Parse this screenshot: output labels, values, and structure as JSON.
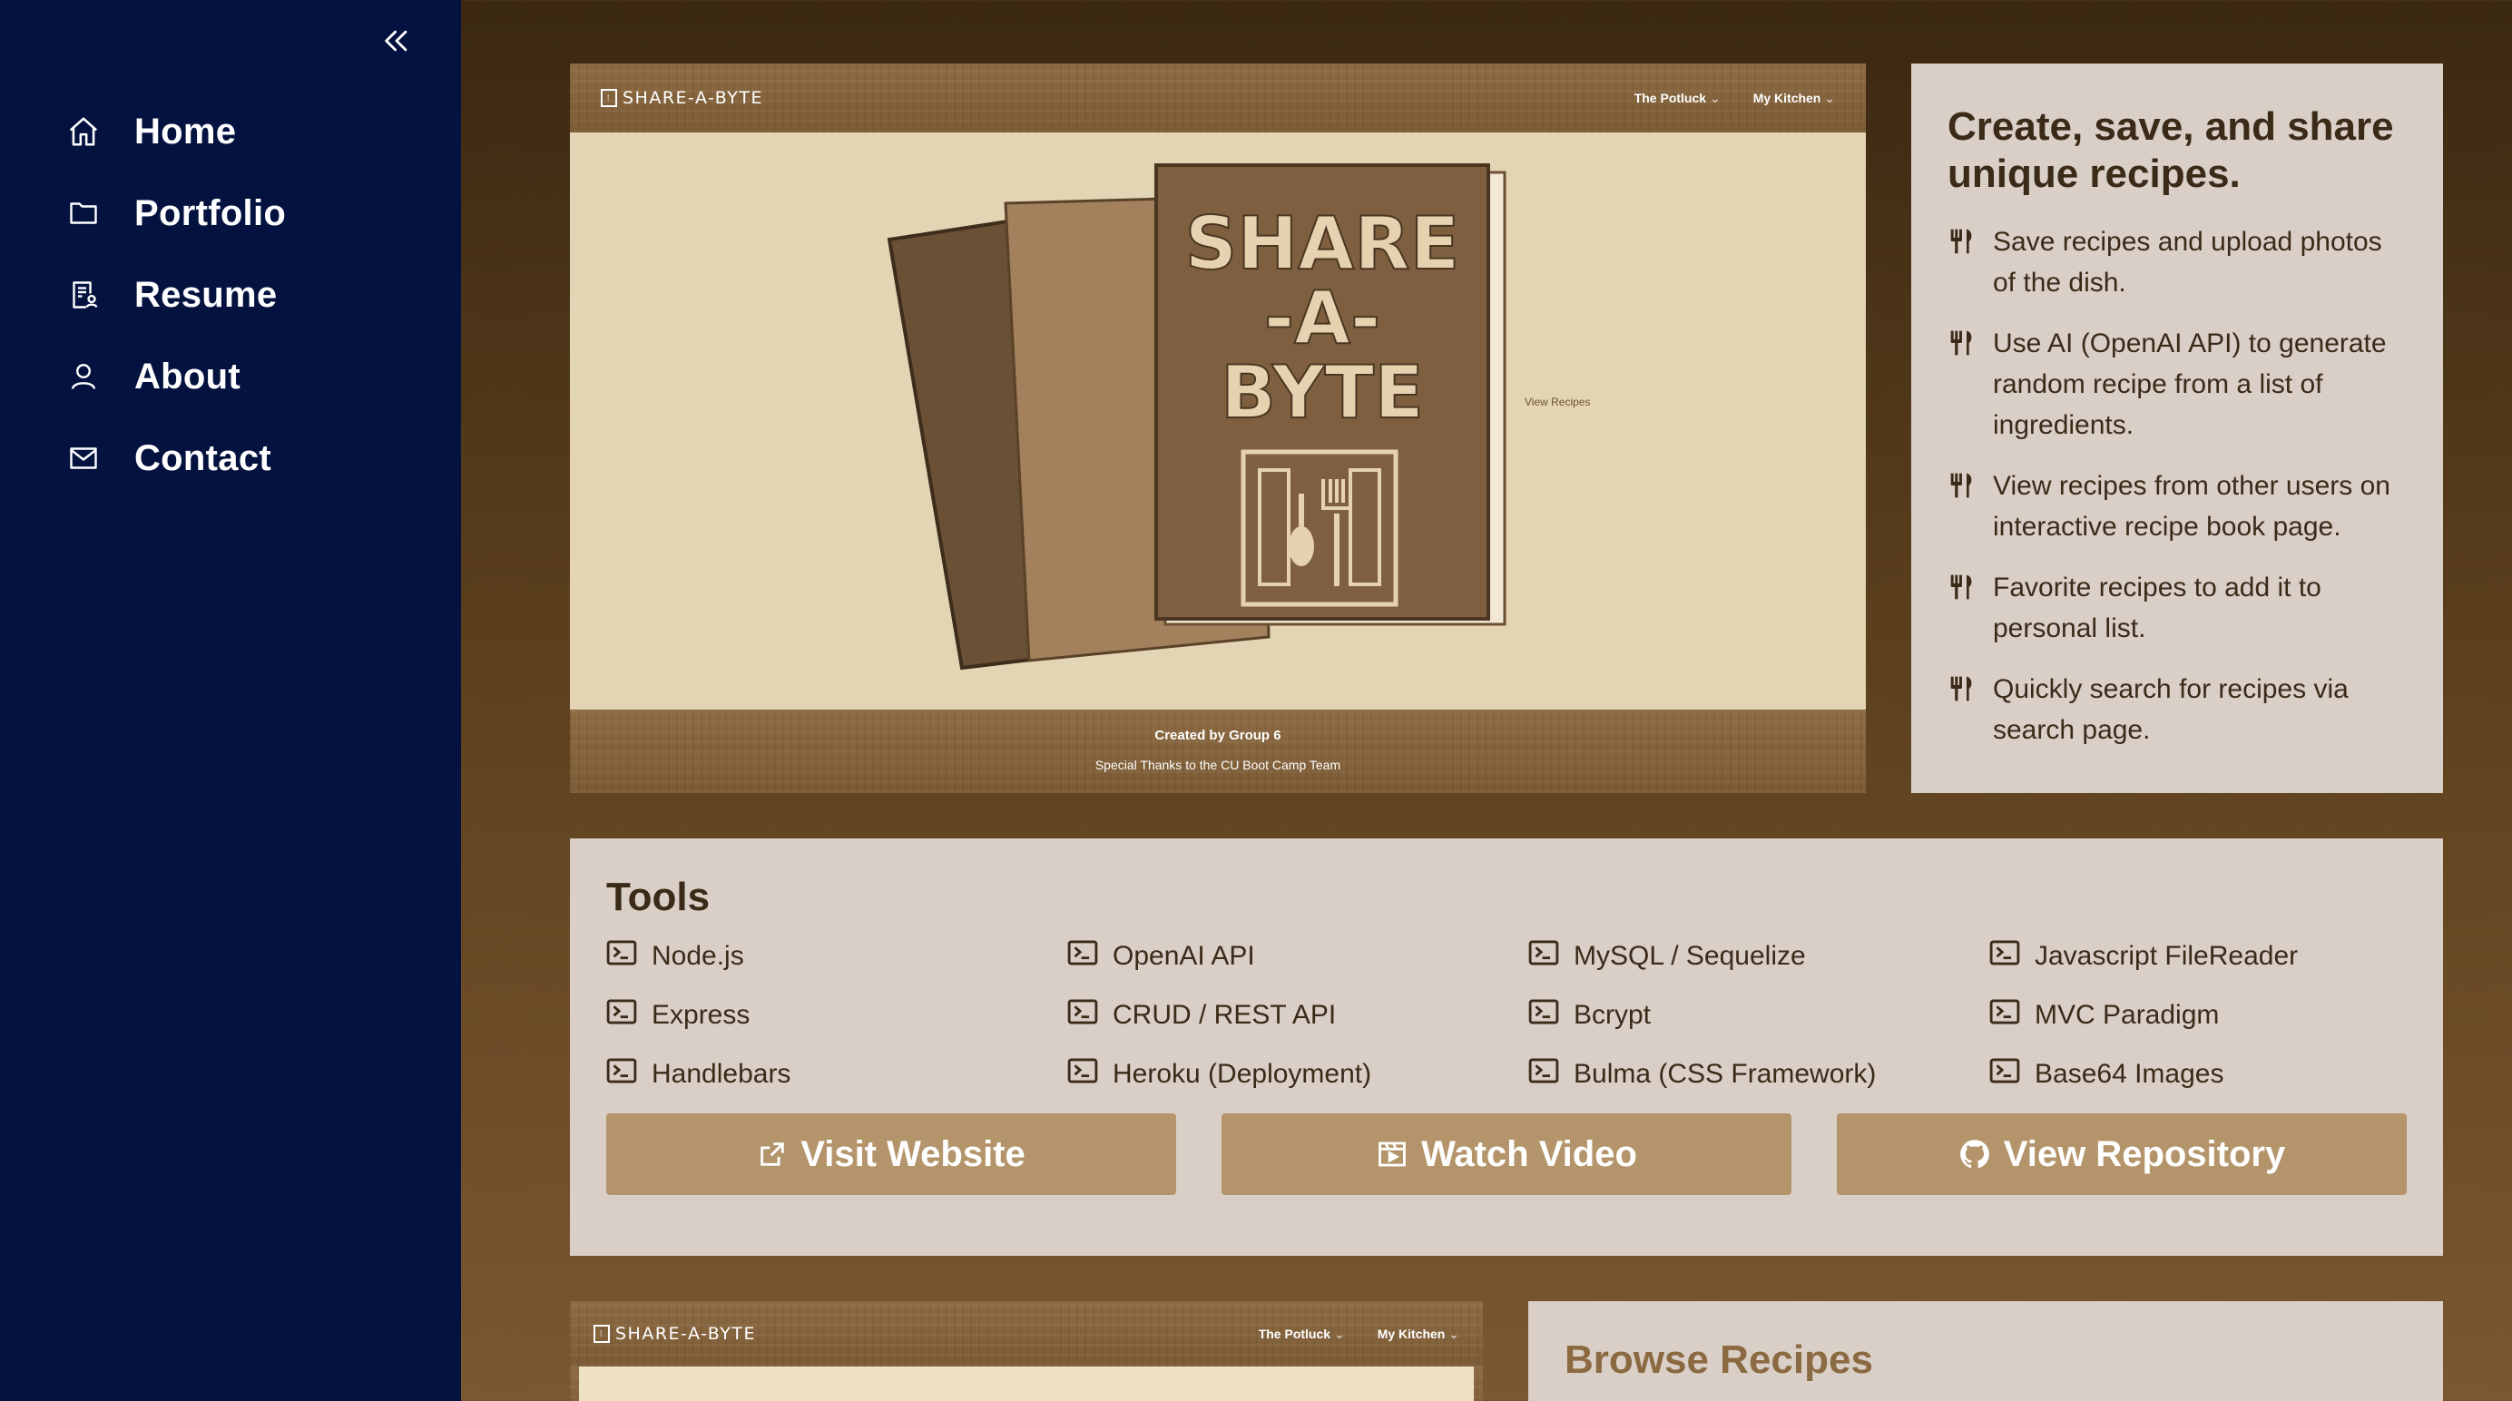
{
  "sidebar": {
    "collapse_icon": "double-chevron-left-icon",
    "items": [
      {
        "label": "Home",
        "icon": "home-icon"
      },
      {
        "label": "Portfolio",
        "icon": "folder-icon"
      },
      {
        "label": "Resume",
        "icon": "resume-icon"
      },
      {
        "label": "About",
        "icon": "user-icon"
      },
      {
        "label": "Contact",
        "icon": "mail-icon"
      }
    ]
  },
  "project_screenshot": {
    "logo": "SHARE-A-BYTE",
    "menu": [
      "The Potluck",
      "My Kitchen"
    ],
    "book_title_lines": [
      "SHARE",
      "-A-",
      "BYTE"
    ],
    "view_recipes": "View Recipes",
    "footer_line1": "Created by Group 6",
    "footer_line2": "Special Thanks to the CU Boot Camp Team"
  },
  "features": {
    "title": "Create, save, and share unique recipes.",
    "items": [
      "Save recipes and upload photos of the dish.",
      "Use AI (OpenAI API) to generate random recipe from a list of ingredients.",
      "View recipes from other users on interactive recipe book page.",
      "Favorite recipes to add it to personal list.",
      "Quickly search for recipes via search page."
    ]
  },
  "tools": {
    "title": "Tools",
    "items": [
      "Node.js",
      "OpenAI API",
      "MySQL / Sequelize",
      "Javascript FileReader",
      "Express",
      "CRUD / REST API",
      "Bcrypt",
      "MVC Paradigm",
      "Handlebars",
      "Heroku (Deployment)",
      "Bulma (CSS Framework)",
      "Base64 Images"
    ],
    "buttons": {
      "visit": "Visit Website",
      "watch": "Watch Video",
      "repo": "View Repository"
    }
  },
  "second_project": {
    "logo": "SHARE-A-BYTE",
    "menu": [
      "The Potluck",
      "My Kitchen"
    ],
    "browse_title": "Browse Recipes"
  },
  "colors": {
    "sidebar_bg": "#04123f",
    "card_bg": "#d9cfc7",
    "button_bg": "#b4956b",
    "text_dark": "#3b2a18"
  }
}
